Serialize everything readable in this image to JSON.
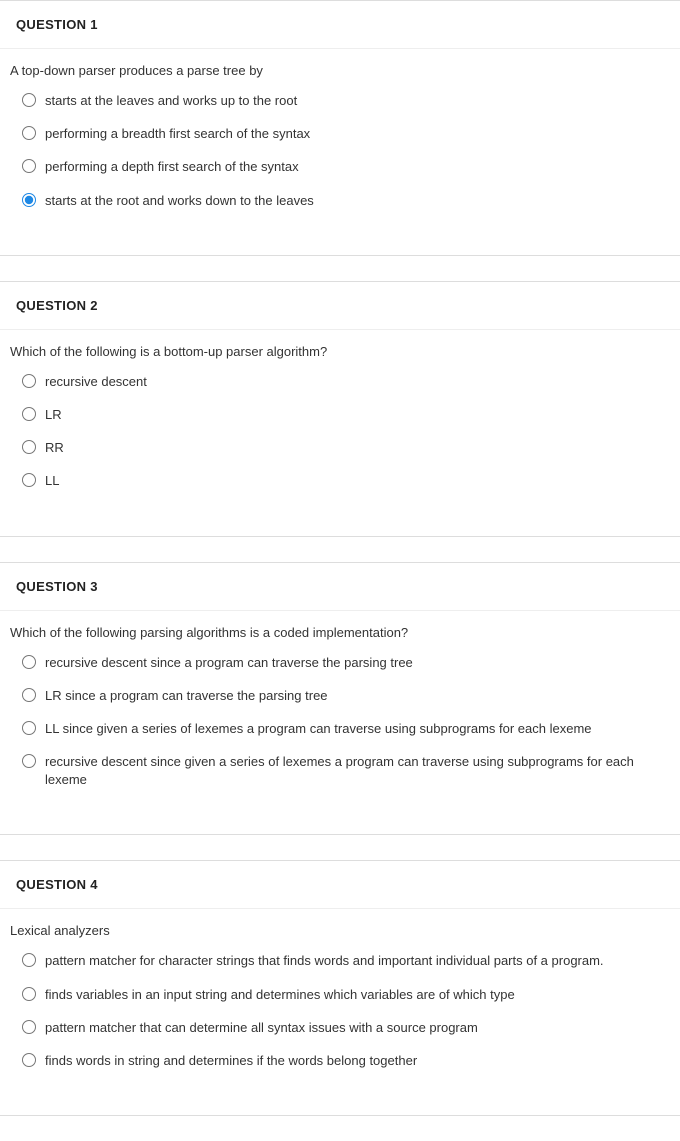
{
  "questions": [
    {
      "title": "QUESTION 1",
      "prompt": "A top-down parser produces a parse tree by",
      "selected_index": 3,
      "options": [
        "starts at the leaves and works up to the root",
        "performing a breadth first search of the syntax",
        "performing a depth first search of the syntax",
        "starts at the root and works down to the leaves"
      ]
    },
    {
      "title": "QUESTION 2",
      "prompt": "Which of the following is a bottom-up parser algorithm?",
      "selected_index": -1,
      "options": [
        "recursive descent",
        "LR",
        "RR",
        "LL"
      ]
    },
    {
      "title": "QUESTION 3",
      "prompt": "Which of the following parsing algorithms is a coded implementation?",
      "selected_index": -1,
      "options": [
        "recursive descent since a program can traverse the parsing tree",
        "LR since a program can traverse the parsing tree",
        "LL  since given a series of lexemes a program can traverse using subprograms for each lexeme",
        "recursive descent since given a series of lexemes a program can traverse using subprograms for each lexeme"
      ]
    },
    {
      "title": "QUESTION 4",
      "prompt": "Lexical analyzers",
      "selected_index": -1,
      "options": [
        "pattern matcher for character strings that finds words and important individual parts of a program.",
        "finds variables in an input string and determines which variables are of which type",
        "pattern matcher that can determine all syntax issues with a source program",
        "finds words in string and determines if the words belong together"
      ]
    }
  ]
}
